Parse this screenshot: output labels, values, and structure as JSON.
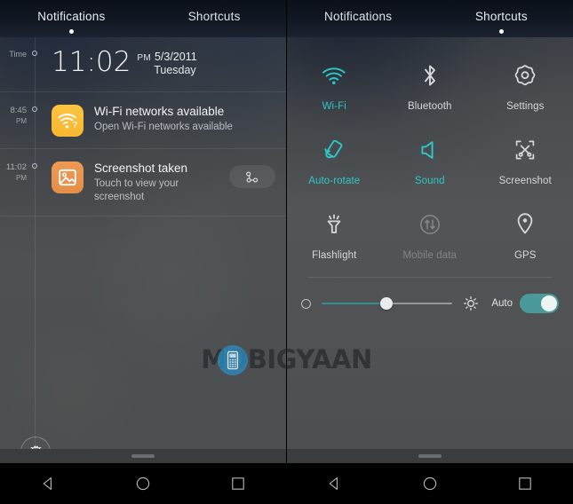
{
  "colors": {
    "accent_teal": "#2ec7c9",
    "toggle_track": "#4a9a9b",
    "slider_fill": "#2f8f91",
    "wifi_icon_bg": "#f8b731",
    "screenshot_icon_bg": "#e68e48",
    "panel_bg": "#4d5051",
    "tabbar_bg": "#121823"
  },
  "left_panel": {
    "tabs": [
      {
        "label": "Notifications",
        "active": true
      },
      {
        "label": "Shortcuts",
        "active": false
      }
    ],
    "clock": {
      "time_label": "Time",
      "time": "11:02",
      "ampm": "PM",
      "date": "5/3/2011",
      "weekday": "Tuesday"
    },
    "notifications": [
      {
        "timestamp": "8:45",
        "timestamp_ampm": "PM",
        "icon": "wifi-question-icon",
        "title": "Wi-Fi networks available",
        "subtitle": "Open Wi-Fi networks available",
        "has_action": false
      },
      {
        "timestamp": "11:02",
        "timestamp_ampm": "PM",
        "icon": "image-icon",
        "title": "Screenshot taken",
        "subtitle": "Touch to view your screenshot",
        "has_action": true,
        "action_icon": "share-icon"
      }
    ],
    "clear_all_icon": "trash-icon"
  },
  "right_panel": {
    "tabs": [
      {
        "label": "Notifications",
        "active": false
      },
      {
        "label": "Shortcuts",
        "active": true
      }
    ],
    "shortcuts": [
      [
        {
          "label": "Wi-Fi",
          "icon": "wifi-icon",
          "state": "on"
        },
        {
          "label": "Bluetooth",
          "icon": "bluetooth-icon",
          "state": "off"
        },
        {
          "label": "Settings",
          "icon": "gear-icon",
          "state": "off"
        }
      ],
      [
        {
          "label": "Auto-rotate",
          "icon": "auto-rotate-icon",
          "state": "on"
        },
        {
          "label": "Sound",
          "icon": "sound-icon",
          "state": "on"
        },
        {
          "label": "Screenshot",
          "icon": "screenshot-icon",
          "state": "off"
        }
      ],
      [
        {
          "label": "Flashlight",
          "icon": "flashlight-icon",
          "state": "off"
        },
        {
          "label": "Mobile data",
          "icon": "mobile-data-icon",
          "state": "dim"
        },
        {
          "label": "GPS",
          "icon": "location-pin-icon",
          "state": "off"
        }
      ]
    ],
    "brightness": {
      "low_icon": "brightness-low-icon",
      "high_icon": "brightness-high-icon",
      "value_percent": 50,
      "auto_label": "Auto",
      "auto_enabled": true
    }
  },
  "watermark": {
    "text": "MOBIGYAAN",
    "logo_icon": "phone-logo-icon"
  },
  "navbar": {
    "buttons": [
      {
        "name": "back",
        "icon": "triangle-back-icon"
      },
      {
        "name": "home",
        "icon": "circle-home-icon"
      },
      {
        "name": "recents",
        "icon": "square-recents-icon"
      }
    ]
  }
}
